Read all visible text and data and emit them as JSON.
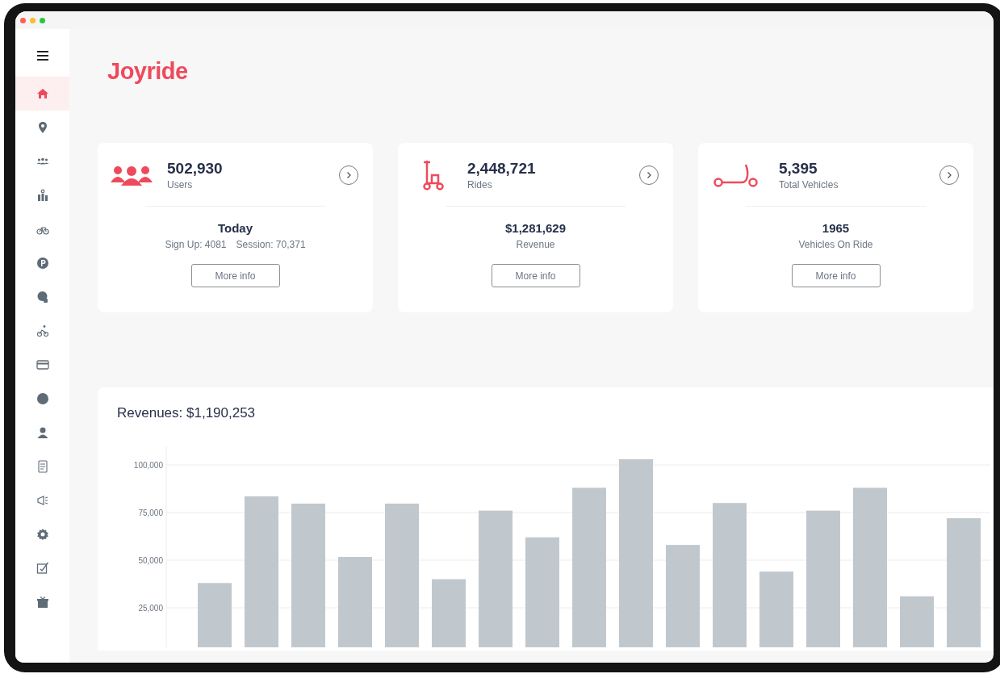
{
  "window": {
    "controls": [
      {
        "color": "#ff5f57"
      },
      {
        "color": "#febc2e"
      },
      {
        "color": "#28c840"
      }
    ]
  },
  "brand": {
    "logo": "Joyride"
  },
  "sidebar": {
    "items": [
      {
        "selected": true
      },
      {
        "selected": false
      },
      {
        "selected": false
      },
      {
        "selected": false
      },
      {
        "selected": false
      },
      {
        "selected": false
      },
      {
        "selected": false
      },
      {
        "selected": false
      },
      {
        "selected": false
      },
      {
        "selected": false
      },
      {
        "selected": false
      },
      {
        "selected": false
      },
      {
        "selected": false
      },
      {
        "selected": false
      },
      {
        "selected": false
      },
      {
        "selected": false
      }
    ]
  },
  "cards": [
    {
      "value": "502,930",
      "label": "Users",
      "today_title": "Today",
      "details": [
        "Sign Up: 4081",
        "Session: 70,371"
      ],
      "button": "More info"
    },
    {
      "value": "2,448,721",
      "label": "Rides",
      "today_title": "$1,281,629",
      "details": [
        "Revenue"
      ],
      "button": "More info"
    },
    {
      "value": "5,395",
      "label": "Total Vehicles",
      "today_title": "1965",
      "details": [
        "Vehicles On Ride"
      ],
      "button": "More info"
    }
  ],
  "revenue": {
    "title": "Revenues: $1,190,253",
    "chart_data": {
      "type": "bar",
      "grid": true,
      "ylim": [
        0,
        110000
      ],
      "yticks": [
        {
          "value": 25000,
          "label": "25,000"
        },
        {
          "value": 50000,
          "label": "50,000"
        },
        {
          "value": 75000,
          "label": "75,000"
        },
        {
          "value": 100000,
          "label": "100,000"
        }
      ],
      "values": [
        38000,
        83500,
        79700,
        51700,
        79700,
        40000,
        76000,
        62000,
        88000,
        103000,
        58000,
        80000,
        44000,
        76000,
        88000,
        31000,
        72000
      ]
    }
  }
}
